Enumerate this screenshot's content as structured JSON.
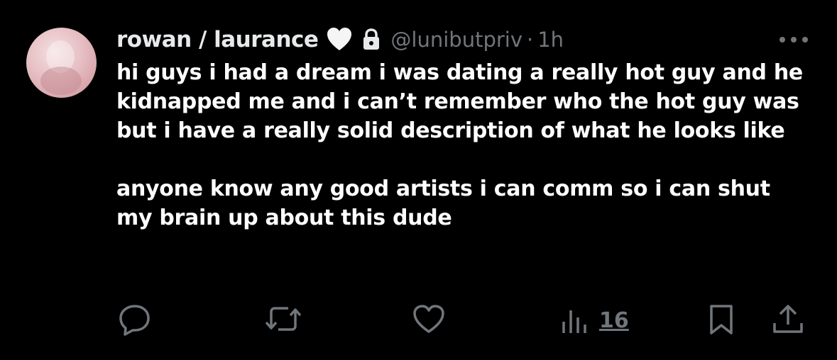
{
  "author": {
    "display_name": "rowan / laurance",
    "handle": "@lunibutpriv",
    "separator": "·",
    "time": "1h",
    "badges": [
      "white-heart-icon",
      "lock-icon"
    ]
  },
  "post": {
    "paragraphs": [
      "hi guys i had a dream i was dating a really hot guy and he kidnapped me and i can’t remember who the hot guy was but i have a really solid description of what he looks like",
      "anyone know any good artists i can comm so i can shut my brain up about this dude"
    ]
  },
  "actions": {
    "reply_icon": "speech-bubble-icon",
    "repost_icon": "repost-arrows-icon",
    "like_icon": "heart-outline-icon",
    "views_icon": "bar-chart-icon",
    "views_count": "16",
    "bookmark_icon": "bookmark-icon",
    "share_icon": "share-upload-icon"
  },
  "colors": {
    "background": "#000000",
    "text": "#ffffff",
    "secondary": "#71767b"
  }
}
